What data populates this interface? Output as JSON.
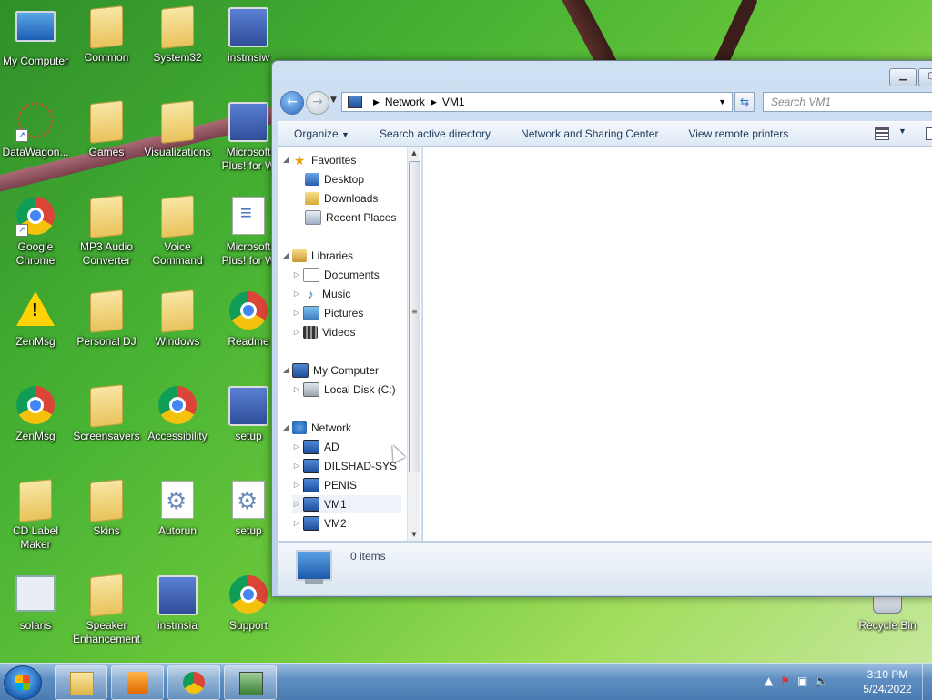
{
  "desktop": {
    "icons": [
      {
        "label": "My Computer"
      },
      {
        "label": "Common"
      },
      {
        "label": "System32"
      },
      {
        "label": "instmsiw"
      },
      {
        "label": "DataWagon..."
      },
      {
        "label": "Games"
      },
      {
        "label": "Visualizations"
      },
      {
        "label": "Microsoft Plus! for W"
      },
      {
        "label": "Google Chrome"
      },
      {
        "label": "MP3 Audio Converter"
      },
      {
        "label": "Voice Command"
      },
      {
        "label": "Microsoft Plus! for W"
      },
      {
        "label": "ZenMsg"
      },
      {
        "label": "Personal DJ"
      },
      {
        "label": "Windows"
      },
      {
        "label": "Readme"
      },
      {
        "label": "ZenMsg"
      },
      {
        "label": "Screensavers"
      },
      {
        "label": "Accessibility"
      },
      {
        "label": "setup"
      },
      {
        "label": "CD Label Maker"
      },
      {
        "label": "Skins"
      },
      {
        "label": "Autorun"
      },
      {
        "label": "setup"
      },
      {
        "label": "solaris"
      },
      {
        "label": "Speaker Enhancement"
      },
      {
        "label": "instmsia"
      },
      {
        "label": "Support"
      },
      {
        "label": "Recycle Bin"
      }
    ]
  },
  "explorer": {
    "address": {
      "segment1": "Network",
      "segment2": "VM1"
    },
    "search_placeholder": "Search VM1",
    "commands": {
      "organize": "Organize",
      "search_ad": "Search active directory",
      "network_sharing": "Network and Sharing Center",
      "remote_printers": "View remote printers"
    },
    "nav": {
      "favorites": "Favorites",
      "desktop": "Desktop",
      "downloads": "Downloads",
      "recent": "Recent Places",
      "libraries": "Libraries",
      "documents": "Documents",
      "music": "Music",
      "pictures": "Pictures",
      "videos": "Videos",
      "my_computer": "My Computer",
      "local_disk": "Local Disk (C:)",
      "network": "Network",
      "ad": "AD",
      "dilshad": "DILSHAD-SYS",
      "penis": "PENIS",
      "vm1": "VM1",
      "vm2": "VM2"
    },
    "details": {
      "items": "0 items"
    }
  },
  "taskbar": {
    "time": "3:10 PM",
    "date": "5/24/2022"
  }
}
